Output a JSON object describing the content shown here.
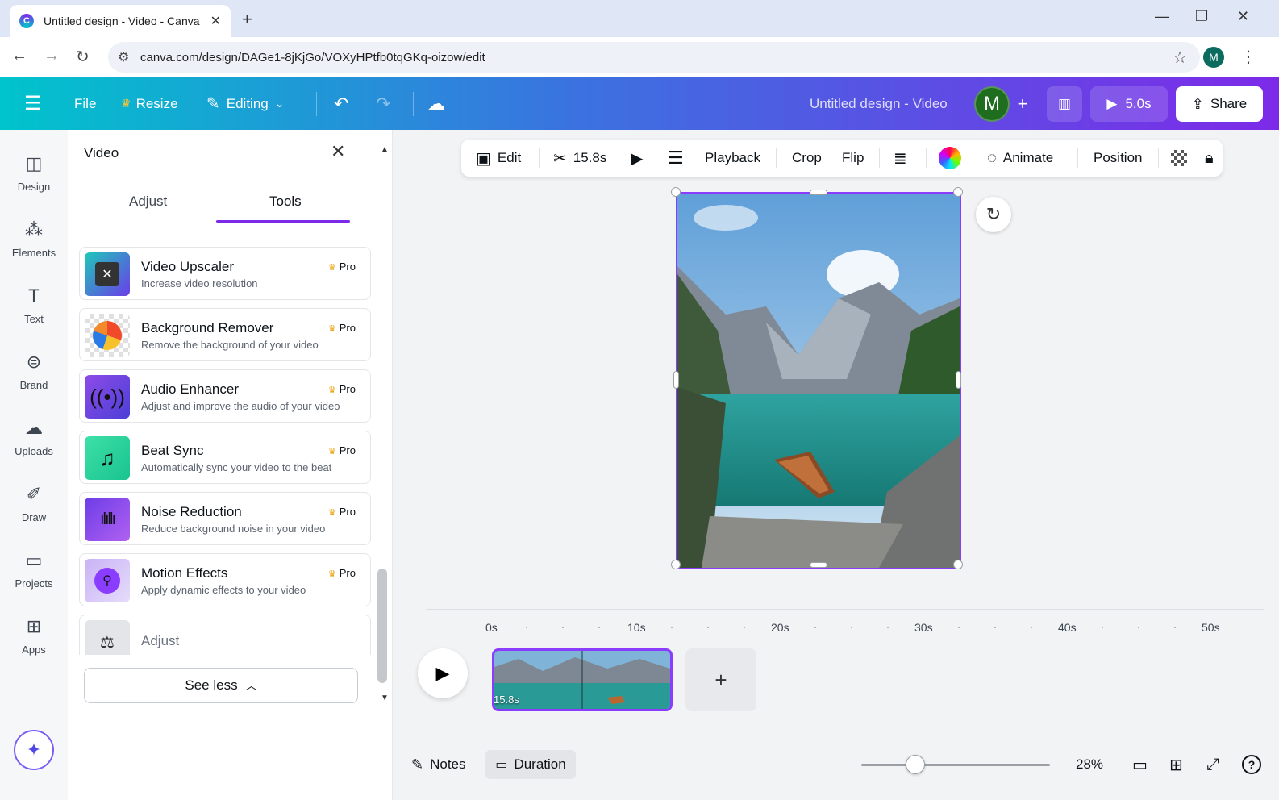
{
  "browser": {
    "tab_title": "Untitled design - Video - Canva",
    "url": "canva.com/design/DAGe1-8jKjGo/VOXyHPtfb0tqGKq-oizow/edit",
    "profile_initial": "M"
  },
  "header": {
    "file": "File",
    "resize": "Resize",
    "editing": "Editing",
    "doc_title": "Untitled design - Video",
    "avatar_initial": "M",
    "present_duration": "5.0s",
    "share": "Share"
  },
  "rail": [
    {
      "label": "Design"
    },
    {
      "label": "Elements"
    },
    {
      "label": "Text"
    },
    {
      "label": "Brand"
    },
    {
      "label": "Uploads"
    },
    {
      "label": "Draw"
    },
    {
      "label": "Projects"
    },
    {
      "label": "Apps"
    }
  ],
  "panel": {
    "title": "Video",
    "tabs": [
      "Adjust",
      "Tools"
    ],
    "active_tab": "Tools",
    "tools": [
      {
        "name": "Video Upscaler",
        "desc": "Increase video resolution",
        "badge": "Pro"
      },
      {
        "name": "Background Remover",
        "desc": "Remove the background of your video",
        "badge": "Pro"
      },
      {
        "name": "Audio Enhancer",
        "desc": "Adjust and improve the audio of your video",
        "badge": "Pro"
      },
      {
        "name": "Beat Sync",
        "desc": "Automatically sync your video to the beat",
        "badge": "Pro"
      },
      {
        "name": "Noise Reduction",
        "desc": "Reduce background noise in your video",
        "badge": "Pro"
      },
      {
        "name": "Motion Effects",
        "desc": "Apply dynamic effects to your video",
        "badge": "Pro"
      },
      {
        "name": "Adjust",
        "desc": "",
        "badge": ""
      }
    ],
    "see_less": "See less"
  },
  "context_toolbar": {
    "edit": "Edit",
    "trim_duration": "15.8s",
    "playback": "Playback",
    "crop": "Crop",
    "flip": "Flip",
    "animate": "Animate",
    "position": "Position"
  },
  "timeline": {
    "ticks": [
      "0s",
      "10s",
      "20s",
      "30s",
      "40s",
      "50s"
    ],
    "clip_duration": "15.8s"
  },
  "footer": {
    "notes": "Notes",
    "duration": "Duration",
    "zoom": "28%"
  },
  "colors": {
    "brand_purple": "#8b3dff",
    "header_gradient_start": "#00c4cc",
    "header_gradient_end": "#7d2ae8"
  }
}
